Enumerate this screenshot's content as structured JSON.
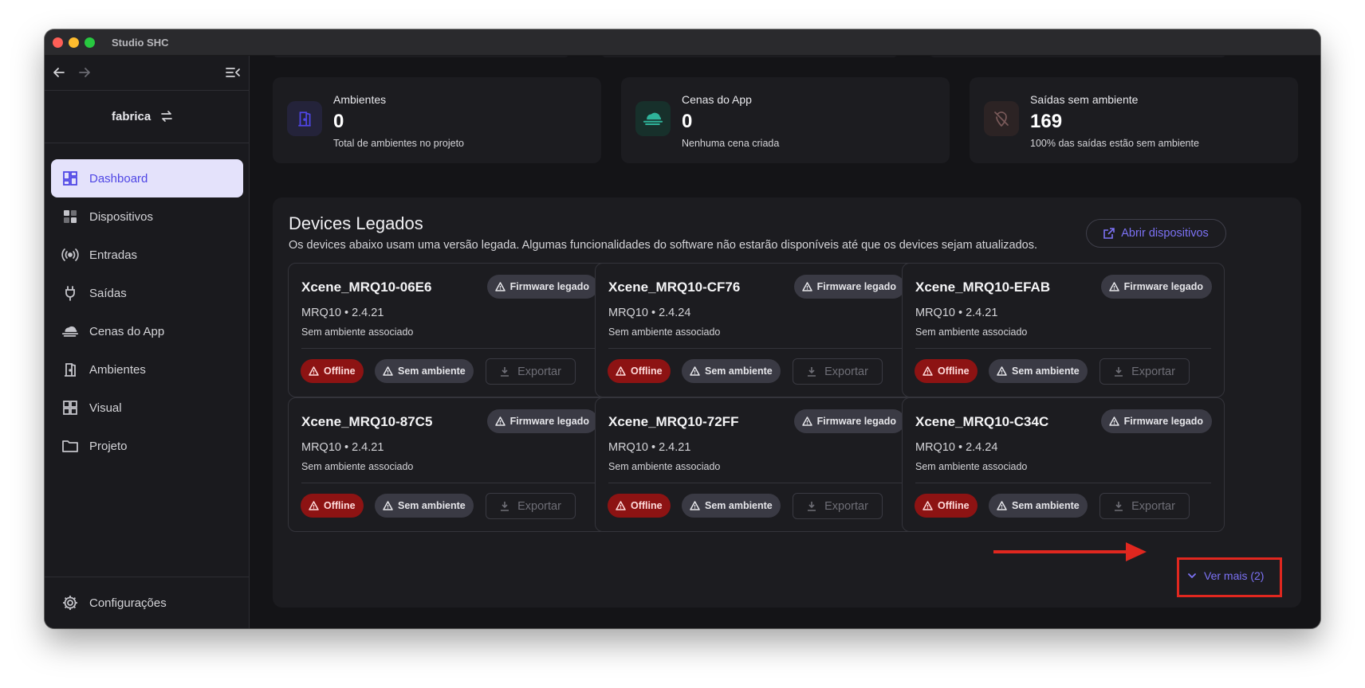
{
  "window": {
    "title": "Studio SHC"
  },
  "sidebar": {
    "project_name": "fabrica",
    "items": [
      {
        "label": "Dashboard",
        "icon": "dashboard-icon",
        "active": true
      },
      {
        "label": "Dispositivos",
        "icon": "devices-icon",
        "active": false
      },
      {
        "label": "Entradas",
        "icon": "signal-icon",
        "active": false
      },
      {
        "label": "Saídas",
        "icon": "plug-icon",
        "active": false
      },
      {
        "label": "Cenas do App",
        "icon": "cloud-icon",
        "active": false
      },
      {
        "label": "Ambientes",
        "icon": "door-icon",
        "active": false
      },
      {
        "label": "Visual",
        "icon": "grid-icon",
        "active": false
      },
      {
        "label": "Projeto",
        "icon": "folder-icon",
        "active": false
      }
    ],
    "settings_label": "Configurações"
  },
  "stats": [
    {
      "label": "Ambientes",
      "value": "0",
      "sub": "Total de ambientes no projeto",
      "icon": "door-icon"
    },
    {
      "label": "Cenas do App",
      "value": "0",
      "sub": "Nenhuma cena criada",
      "icon": "cloud-icon"
    },
    {
      "label": "Saídas sem ambiente",
      "value": "169",
      "sub": "100% das saídas estão sem ambiente",
      "icon": "location-off-icon"
    }
  ],
  "legacy": {
    "title": "Devices Legados",
    "description": "Os devices abaixo usam uma versão legada. Algumas funcionalidades do software não estarão disponíveis até que os devices sejam atualizados.",
    "open_button": "Abrir dispositivos",
    "badge_firmware": "Firmware legado",
    "status_offline": "Offline",
    "badge_no_env": "Sem ambiente",
    "export_label": "Exportar",
    "see_more": "Ver mais (2)",
    "devices": [
      {
        "name": "Xcene_MRQ10-06E6",
        "model": "MRQ10 • 2.4.21",
        "env": "Sem ambiente associado"
      },
      {
        "name": "Xcene_MRQ10-CF76",
        "model": "MRQ10 • 2.4.24",
        "env": "Sem ambiente associado"
      },
      {
        "name": "Xcene_MRQ10-EFAB",
        "model": "MRQ10 • 2.4.21",
        "env": "Sem ambiente associado"
      },
      {
        "name": "Xcene_MRQ10-87C5",
        "model": "MRQ10 • 2.4.21",
        "env": "Sem ambiente associado"
      },
      {
        "name": "Xcene_MRQ10-72FF",
        "model": "MRQ10 • 2.4.21",
        "env": "Sem ambiente associado"
      },
      {
        "name": "Xcene_MRQ10-C34C",
        "model": "MRQ10 • 2.4.24",
        "env": "Sem ambiente associado"
      }
    ]
  },
  "colors": {
    "accent": "#4f46e5",
    "offline": "#8d1313",
    "annotation": "#e0271f"
  }
}
